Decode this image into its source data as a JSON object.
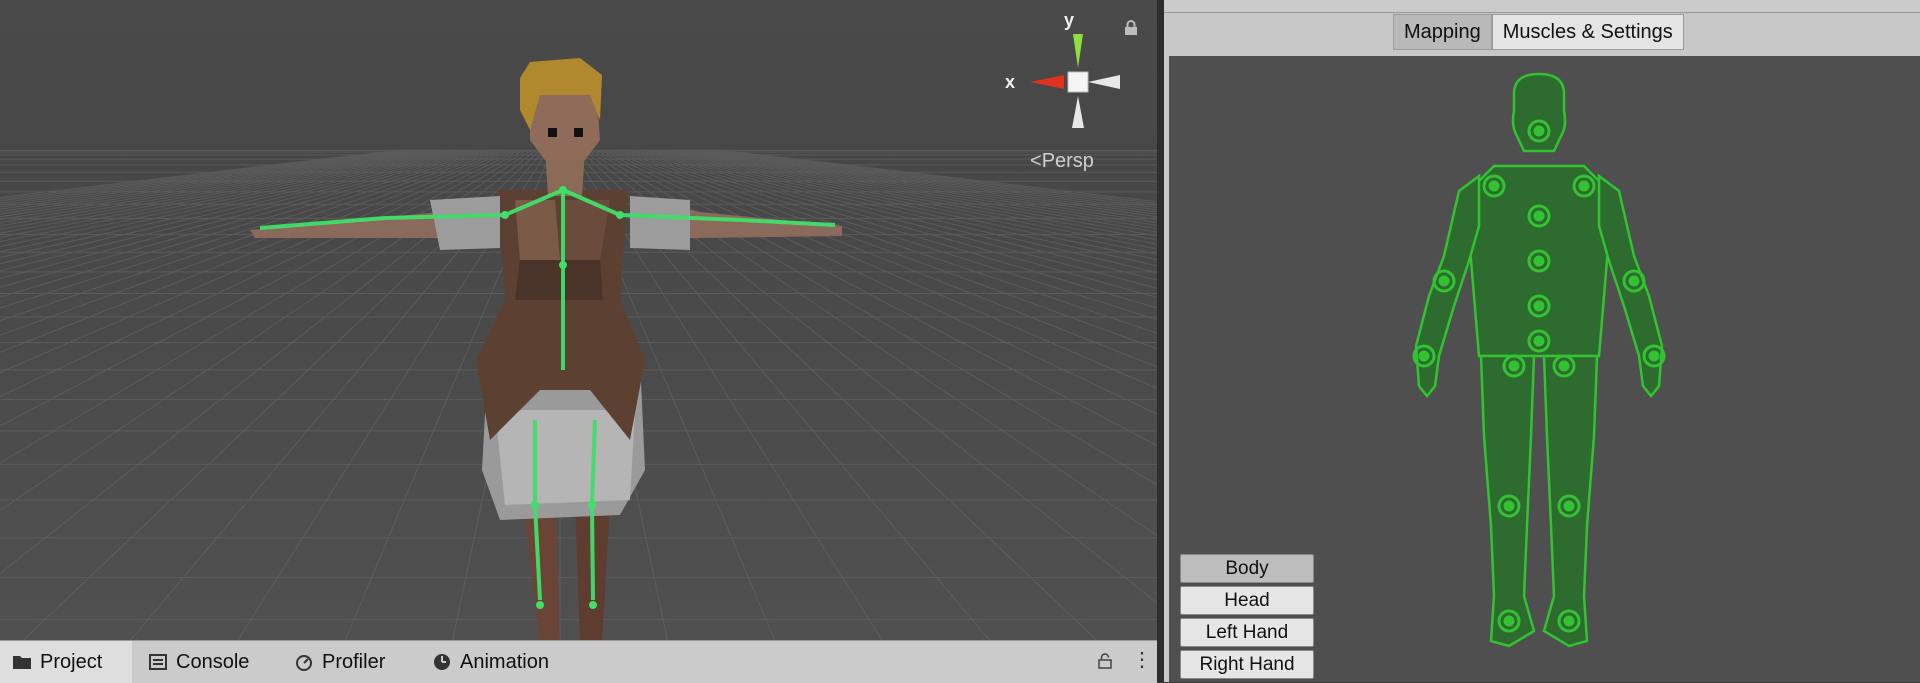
{
  "scene": {
    "projection_label": "Persp",
    "axis_x": "x",
    "axis_y": "y",
    "colors": {
      "bone": "#3fe06a",
      "x_axis": "#e0321e",
      "y_axis": "#8fe03c"
    }
  },
  "inspector": {
    "tabs": [
      {
        "label": "Mapping",
        "active": true
      },
      {
        "label": "Muscles & Settings",
        "active": false
      }
    ],
    "body_parts": [
      {
        "label": "Body",
        "active": true
      },
      {
        "label": "Head",
        "active": false
      },
      {
        "label": "Left Hand",
        "active": false
      },
      {
        "label": "Right Hand",
        "active": false
      }
    ],
    "avatar_color": "#32c232"
  },
  "bottom_tabs": [
    {
      "label": "Project",
      "icon": "folder-icon",
      "active": true
    },
    {
      "label": "Console",
      "icon": "console-icon",
      "active": false
    },
    {
      "label": "Profiler",
      "icon": "profiler-icon",
      "active": false
    },
    {
      "label": "Animation",
      "icon": "animation-icon",
      "active": false
    }
  ]
}
